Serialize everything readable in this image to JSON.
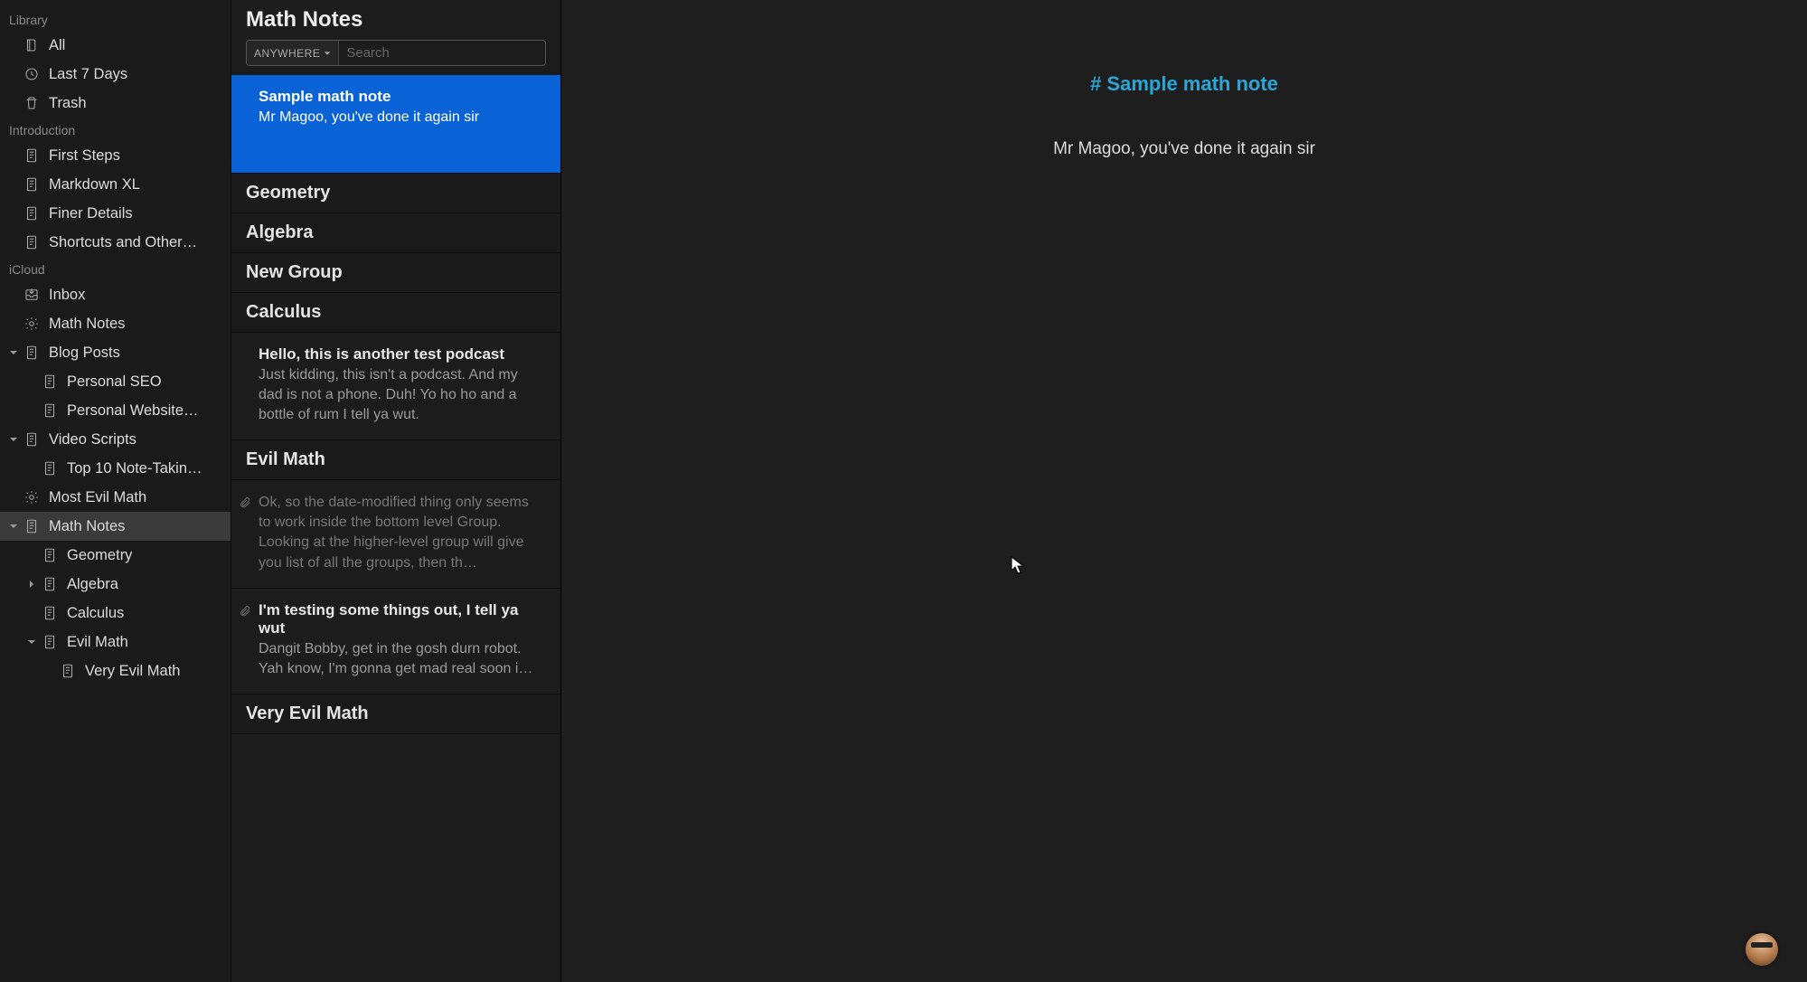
{
  "sidebar": {
    "sections": [
      {
        "header": "Library",
        "items": [
          {
            "icon": "stack",
            "label": "All"
          },
          {
            "icon": "clock",
            "label": "Last 7 Days"
          },
          {
            "icon": "trash",
            "label": "Trash"
          }
        ]
      },
      {
        "header": "Introduction",
        "items": [
          {
            "icon": "note",
            "label": "First Steps"
          },
          {
            "icon": "note",
            "label": "Markdown XL"
          },
          {
            "icon": "note",
            "label": "Finer Details"
          },
          {
            "icon": "note",
            "label": "Shortcuts and Other…"
          }
        ]
      },
      {
        "header": "iCloud",
        "items": [
          {
            "icon": "inbox",
            "label": "Inbox"
          },
          {
            "icon": "gear",
            "label": "Math Notes"
          },
          {
            "icon": "note",
            "label": "Blog Posts",
            "disclosure": "down",
            "children": [
              {
                "icon": "note",
                "label": "Personal SEO"
              },
              {
                "icon": "note",
                "label": "Personal Website…"
              }
            ]
          },
          {
            "icon": "note",
            "label": "Video Scripts",
            "disclosure": "down",
            "children": [
              {
                "icon": "note",
                "label": "Top 10 Note-Takin…"
              }
            ]
          },
          {
            "icon": "gear",
            "label": "Most Evil Math"
          },
          {
            "icon": "note",
            "label": "Math Notes",
            "disclosure": "down",
            "selected": true,
            "children": [
              {
                "icon": "note",
                "label": "Geometry"
              },
              {
                "icon": "note",
                "label": "Algebra",
                "disclosure": "right"
              },
              {
                "icon": "note",
                "label": "Calculus"
              },
              {
                "icon": "note",
                "label": "Evil Math",
                "disclosure": "down",
                "children": [
                  {
                    "icon": "note",
                    "label": "Very Evil Math"
                  }
                ]
              }
            ]
          }
        ]
      }
    ]
  },
  "notelist": {
    "title": "Math Notes",
    "search_scope": "ANYWHERE",
    "search_placeholder": "Search",
    "entries": [
      {
        "kind": "note",
        "title": "Sample math note",
        "preview": "Mr Magoo, you've done it again sir",
        "selected": true
      },
      {
        "kind": "group",
        "label": "Geometry"
      },
      {
        "kind": "group",
        "label": "Algebra"
      },
      {
        "kind": "group",
        "label": "New Group"
      },
      {
        "kind": "group",
        "label": "Calculus"
      },
      {
        "kind": "note",
        "title": "Hello, this is another test podcast",
        "preview": "Just kidding, this isn't a podcast. And my dad is not a phone. Duh! Yo ho ho and a bottle of rum I tell ya wut."
      },
      {
        "kind": "group",
        "label": "Evil Math"
      },
      {
        "kind": "note",
        "untitled": true,
        "attachment": true,
        "preview": "Ok, so the date-modified thing only seems to work inside the bottom level Group. Looking at the higher-level group will give you list of all the groups, then th…"
      },
      {
        "kind": "note",
        "title": "I'm testing some things out, I tell ya wut",
        "attachment": true,
        "preview": "Dangit Bobby, get in the gosh durn robot. Yah know, I'm gonna get mad real soon i…"
      },
      {
        "kind": "group",
        "label": "Very Evil Math"
      }
    ]
  },
  "editor": {
    "title_raw": "# Sample math note",
    "body": "Mr Magoo, you've done it again sir"
  },
  "colors": {
    "selection_blue": "#0a63d6",
    "heading_cyan": "#2aa7d6"
  }
}
